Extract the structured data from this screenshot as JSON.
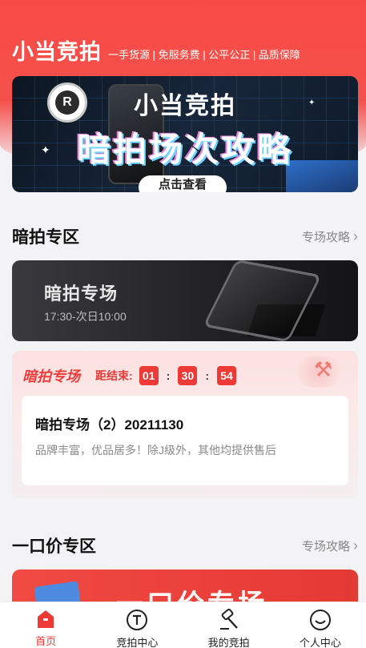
{
  "header": {
    "title": "小当竞拍",
    "tags": "一手货源 | 免服务费 | 公平公正 | 品质保障"
  },
  "banner": {
    "title": "小当竞拍",
    "subtitle": "暗拍场次攻略",
    "button_label": "点击查看"
  },
  "dark_section": {
    "title": "暗拍专区",
    "link_label": "专场攻略",
    "card_title": "暗拍专场",
    "card_time": "17:30-次日10:00"
  },
  "auction": {
    "label": "暗拍专场",
    "countdown_label": "距结束:",
    "hours": "01",
    "minutes": "30",
    "seconds": "54",
    "name": "暗拍专场（2）20211130",
    "desc": "品牌丰富，优品居多！除J级外，其他均提供售后"
  },
  "fixed_section": {
    "title": "一口价专区",
    "link_label": "专场攻略",
    "banner_text": "一口价专场"
  },
  "tabbar": {
    "items": [
      {
        "label": "首页",
        "icon": "home-icon",
        "active": true
      },
      {
        "label": "竞拍中心",
        "icon": "auction-center-icon",
        "active": false
      },
      {
        "label": "我的竞拍",
        "icon": "hammer-icon",
        "active": false
      },
      {
        "label": "个人中心",
        "icon": "profile-icon",
        "active": false
      }
    ]
  },
  "colors": {
    "accent": "#ee3a36",
    "header": "#f84a45"
  }
}
